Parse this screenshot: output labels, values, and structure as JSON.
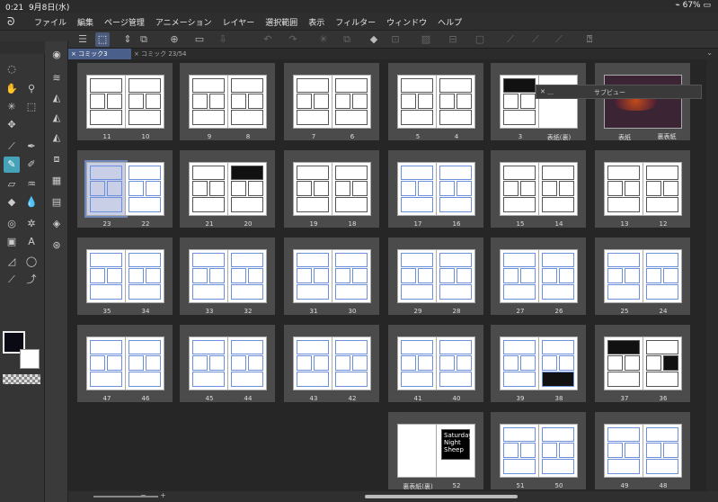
{
  "status": {
    "time": "0:21",
    "date": "9月8日(水)",
    "battery": "67%"
  },
  "menu": [
    "ファイル",
    "編集",
    "ページ管理",
    "アニメーション",
    "レイヤー",
    "選択範囲",
    "表示",
    "フィルター",
    "ウィンドウ",
    "ヘルプ"
  ],
  "tabs": [
    {
      "label": "× コミック3",
      "active": true
    },
    {
      "label": "× コミック 23/54",
      "active": false
    }
  ],
  "popup": {
    "close": "✕ ＿",
    "title": "サブビュー"
  },
  "icons": {
    "cmd": [
      "menu-icon",
      "select-tool-icon",
      "rotate-icon",
      "layer-view-icon",
      "new-page-icon",
      "open-file-icon",
      "save-icon",
      "undo-icon",
      "redo-icon",
      "transform-icon",
      "copy-icon",
      "fill-icon",
      "crop-icon",
      "deselect-icon",
      "invert-icon",
      "frame-icon",
      "ruler-icon",
      "ruler2-icon",
      "ruler3-icon",
      "help-icon"
    ]
  },
  "pages": {
    "row1": [
      [
        "11",
        "10"
      ],
      [
        "9",
        "8"
      ],
      [
        "7",
        "6"
      ],
      [
        "5",
        "4"
      ],
      [
        "3",
        "表紙(裏)"
      ],
      [
        "表紙",
        "裏表紙"
      ]
    ],
    "row2": [
      [
        "23",
        "22"
      ],
      [
        "21",
        "20"
      ],
      [
        "19",
        "18"
      ],
      [
        "17",
        "16"
      ],
      [
        "15",
        "14"
      ],
      [
        "13",
        "12"
      ]
    ],
    "row3": [
      [
        "35",
        "34"
      ],
      [
        "33",
        "32"
      ],
      [
        "31",
        "30"
      ],
      [
        "29",
        "28"
      ],
      [
        "27",
        "26"
      ],
      [
        "25",
        "24"
      ]
    ],
    "row4": [
      [
        "47",
        "46"
      ],
      [
        "45",
        "44"
      ],
      [
        "43",
        "42"
      ],
      [
        "41",
        "40"
      ],
      [
        "39",
        "38"
      ],
      [
        "37",
        "36"
      ]
    ],
    "row5": [
      [
        "裏表紙(裏)",
        "52"
      ],
      [
        "51",
        "50"
      ],
      [
        "49",
        "48"
      ]
    ]
  },
  "cover52": {
    "text": "Saturday Night Sheep"
  },
  "colors": {
    "accent": "#4a5f8a",
    "selectedTool": "#46a2b6",
    "sketch": "#6b8fd8"
  }
}
